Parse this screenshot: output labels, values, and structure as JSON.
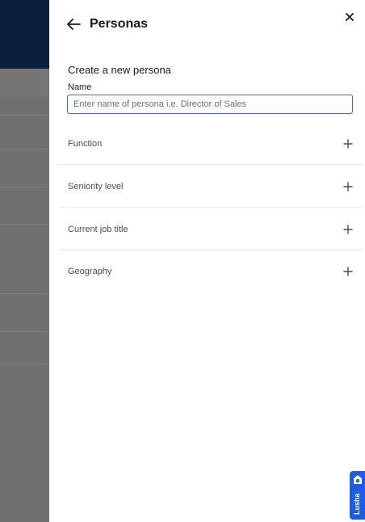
{
  "drawer": {
    "title": "Personas",
    "section_title": "Create a new persona",
    "name_label": "Name",
    "name_placeholder": "Enter name of persona i.e. Director of Sales",
    "name_value": "",
    "filters": [
      {
        "label": "Function"
      },
      {
        "label": "Seniority level"
      },
      {
        "label": "Current job title"
      },
      {
        "label": "Geography"
      }
    ]
  },
  "lusha_tab": {
    "label": "Lusha"
  },
  "colors": {
    "header_bg": "#0c1f3c",
    "input_focus": "#2f74d0",
    "lusha_blue": "#1d5ce6"
  },
  "icons": {
    "back": "arrow-left-icon",
    "close": "close-icon",
    "expand": "plus-icon",
    "lusha": "lusha-logo-icon"
  }
}
